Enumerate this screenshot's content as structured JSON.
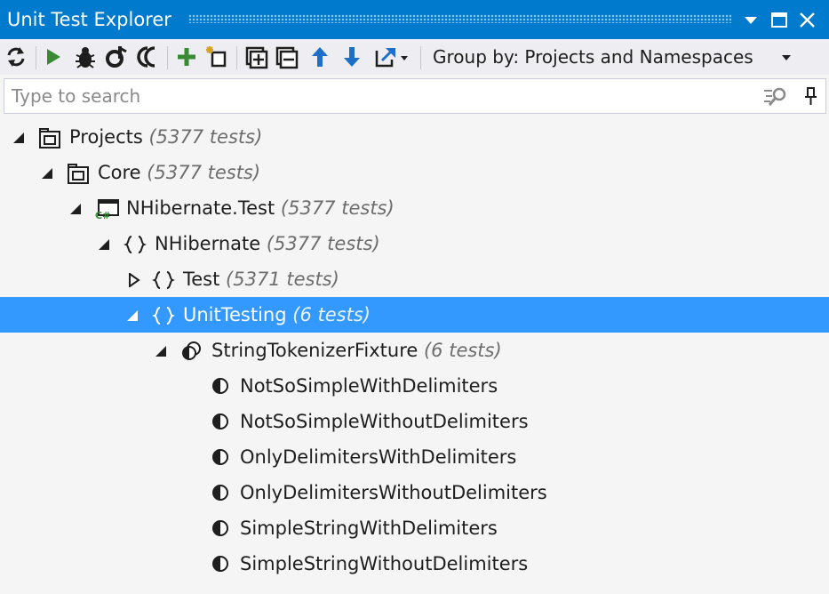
{
  "window": {
    "title": "Unit Test Explorer"
  },
  "toolbar": {
    "buttons": [
      "refresh-icon",
      "run-icon",
      "debug-icon",
      "cover-icon",
      "profile-icon",
      "add-icon",
      "new-session-icon",
      "expand-all-icon",
      "collapse-all-icon",
      "previous-icon",
      "next-icon",
      "export-icon"
    ],
    "group_by_label": "Group by: Projects and Namespaces"
  },
  "search": {
    "placeholder": "Type to search"
  },
  "tree": [
    {
      "label": "Projects",
      "count": "(5377 tests)",
      "icon": "project-folder-icon",
      "expanded": true
    },
    {
      "label": "Core",
      "count": "(5377 tests)",
      "icon": "project-folder-icon",
      "expanded": true
    },
    {
      "label": "NHibernate.Test",
      "count": "(5377 tests)",
      "icon": "csharp-project-icon",
      "expanded": true
    },
    {
      "label": "NHibernate",
      "count": "(5377 tests)",
      "icon": "namespace-icon",
      "expanded": true
    },
    {
      "label": "Test",
      "count": "(5371 tests)",
      "icon": "namespace-icon",
      "expanded": false
    },
    {
      "label": "UnitTesting",
      "count": "(6 tests)",
      "icon": "namespace-icon",
      "expanded": true,
      "selected": true
    },
    {
      "label": "StringTokenizerFixture",
      "count": "(6 tests)",
      "icon": "test-fixture-icon",
      "expanded": true
    },
    {
      "label": "NotSoSimpleWithDelimiters",
      "icon": "test-icon"
    },
    {
      "label": "NotSoSimpleWithoutDelimiters",
      "icon": "test-icon"
    },
    {
      "label": "OnlyDelimitersWithDelimiters",
      "icon": "test-icon"
    },
    {
      "label": "OnlyDelimitersWithoutDelimiters",
      "icon": "test-icon"
    },
    {
      "label": "SimpleStringWithDelimiters",
      "icon": "test-icon"
    },
    {
      "label": "SimpleStringWithoutDelimiters",
      "icon": "test-icon"
    }
  ],
  "colors": {
    "accent": "#007acc",
    "selection": "#3399ff",
    "run_green": "#388a34",
    "arrow_blue": "#1e6fc7"
  }
}
